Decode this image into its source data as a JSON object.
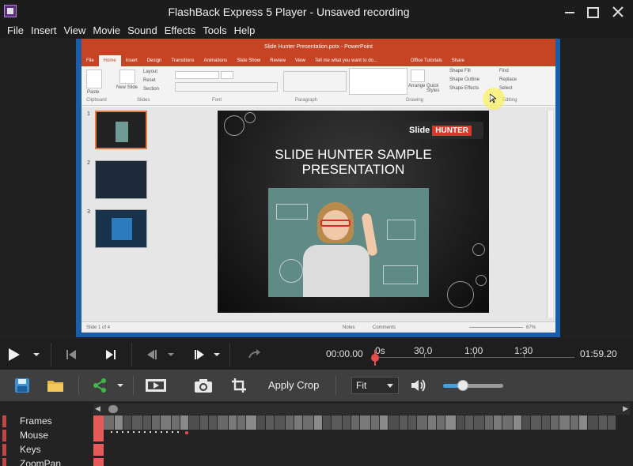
{
  "window": {
    "title": "FlashBack Express 5 Player - Unsaved recording",
    "icon": "flashback-app-icon"
  },
  "menu": [
    "File",
    "Insert",
    "View",
    "Movie",
    "Sound",
    "Effects",
    "Tools",
    "Help"
  ],
  "video": {
    "ppt_window_title": "Slide Hunter Presentation.potx - PowerPoint",
    "ppt_tabs": [
      "File",
      "Home",
      "Insert",
      "Design",
      "Transitions",
      "Animations",
      "Slide Show",
      "Review",
      "View",
      "Tell me what you want to do...",
      "Office Tutorials",
      "Share"
    ],
    "ribbon_groups": [
      "Clipboard",
      "Slides",
      "Font",
      "Paragraph",
      "Drawing",
      "Editing"
    ],
    "ribbon_items": {
      "paste": "Paste",
      "new_slide": "New Slide",
      "layout": "Layout",
      "reset": "Reset",
      "section": "Section",
      "arrange": "Arrange",
      "quick_styles": "Quick Styles",
      "shape_fill": "Shape Fill",
      "shape_outline": "Shape Outline",
      "shape_effects": "Shape Effects",
      "find": "Find",
      "replace": "Replace",
      "select": "Select"
    },
    "thumbnails": [
      "1",
      "2",
      "3"
    ],
    "slide": {
      "logo_slide": "Slide",
      "logo_hunter": "HUNTER",
      "title_line1": "SLIDE HUNTER SAMPLE",
      "title_line2": "PRESENTATION"
    },
    "status_left": "Slide 1 of 4",
    "status_notes": "Notes",
    "status_comments": "Comments",
    "zoom": "67%"
  },
  "playback": {
    "current_time": "00:00.00",
    "total_time": "01:59.20",
    "ruler": [
      "0s",
      "30.0",
      "1:00",
      "1:30"
    ],
    "progress": 0.0
  },
  "toolbar": {
    "apply_crop": "Apply Crop",
    "zoom_select": "Fit",
    "volume_level": 0.33
  },
  "timeline": {
    "tracks": [
      "Frames",
      "Mouse",
      "Keys",
      "ZoomPan"
    ]
  },
  "colors": {
    "accent_red": "#e84b4b",
    "volume_blue": "#3ea2e5",
    "ppt_orange": "#c64424"
  }
}
